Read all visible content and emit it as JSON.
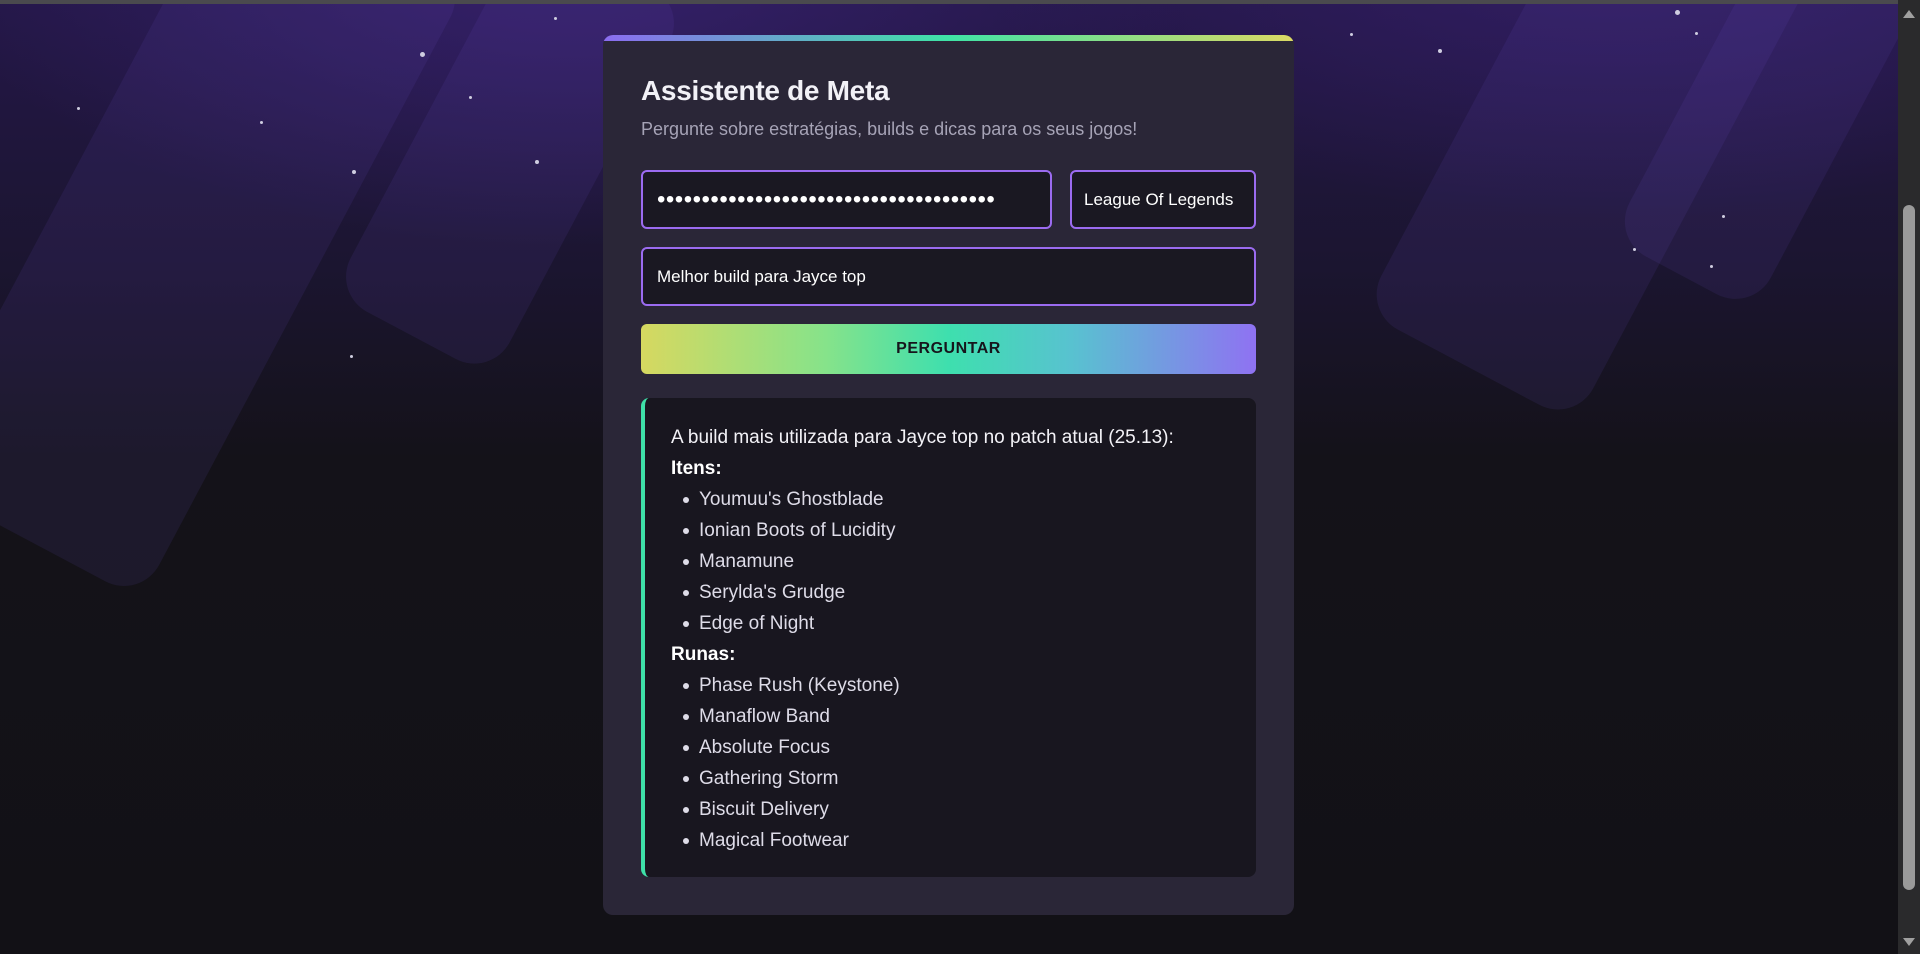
{
  "app": {
    "title": "Assistente de Meta",
    "subtitle": "Pergunte sobre estratégias, builds e dicas para os seus jogos!"
  },
  "form": {
    "api_key_value": "••••••••••••••••••••••••••••••••••••••",
    "game_selected": "League Of Legends",
    "question_value": "Melhor build para Jayce top",
    "ask_label": "PERGUNTAR"
  },
  "answer": {
    "intro": "A build mais utilizada para Jayce top no patch atual (25.13):",
    "items_heading": "Itens:",
    "items": [
      "Youmuu's Ghostblade",
      "Ionian Boots of Lucidity",
      "Manamune",
      "Serylda's Grudge",
      "Edge of Night"
    ],
    "runes_heading": "Runas:",
    "runes": [
      "Phase Rush (Keystone)",
      "Manaflow Band",
      "Absolute Focus",
      "Gathering Storm",
      "Biscuit Delivery",
      "Magical Footwear"
    ]
  },
  "theme": {
    "accent_purple": "#9b6bf0",
    "accent_green": "#3ee0a8",
    "accent_yellow": "#d6d860",
    "card_bg": "#2a2637"
  }
}
